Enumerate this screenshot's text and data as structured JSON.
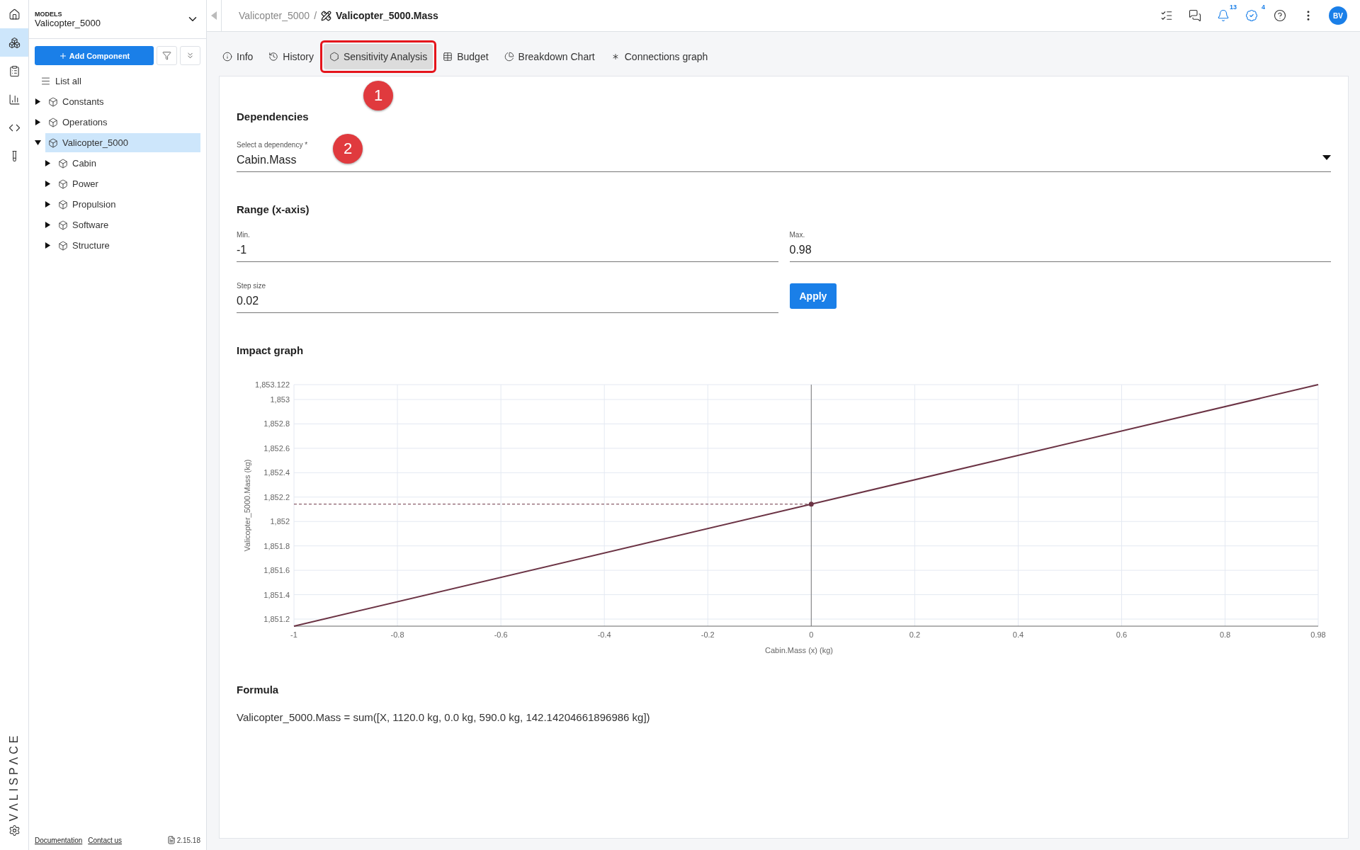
{
  "rail": {
    "items": [
      {
        "selected": false
      },
      {
        "selected": true
      },
      {
        "selected": false
      },
      {
        "selected": false
      },
      {
        "selected": false
      },
      {
        "selected": false
      }
    ],
    "logo": "VΛLISPΛCE"
  },
  "sidebar": {
    "caption": "MODELS",
    "model": "Valicopter_5000",
    "add_button": "Add Component",
    "list_all": "List all",
    "tree": [
      {
        "label": "Constants",
        "expanded": false,
        "selected": false
      },
      {
        "label": "Operations",
        "expanded": false,
        "selected": false
      },
      {
        "label": "Valicopter_5000",
        "expanded": true,
        "selected": true,
        "children": [
          {
            "label": "Cabin",
            "expanded": false,
            "selected": false
          },
          {
            "label": "Power",
            "expanded": false,
            "selected": false
          },
          {
            "label": "Propulsion",
            "expanded": false,
            "selected": false
          },
          {
            "label": "Software",
            "expanded": false,
            "selected": false
          },
          {
            "label": "Structure",
            "expanded": false,
            "selected": false
          }
        ]
      }
    ],
    "footer": {
      "links": [
        "Documentation",
        "Contact us"
      ],
      "version": "2.15.18"
    }
  },
  "topbar": {
    "breadcrumb": {
      "parent": "Valicopter_5000",
      "separator": "/",
      "current": "Valicopter_5000.Mass"
    },
    "notifications": "13",
    "tasks": "4",
    "avatar": "BV"
  },
  "tabs": [
    {
      "label": "Info",
      "selected": false
    },
    {
      "label": "History",
      "selected": false
    },
    {
      "label": "Sensitivity Analysis",
      "selected": true
    },
    {
      "label": "Budget",
      "selected": false
    },
    {
      "label": "Breakdown Chart",
      "selected": false
    },
    {
      "label": "Connections graph",
      "selected": false
    }
  ],
  "annotations": [
    {
      "kind": "tab",
      "number": "1"
    },
    {
      "kind": "dependency",
      "number": "2"
    }
  ],
  "dependencies": {
    "title": "Dependencies",
    "label": "Select a dependency *",
    "value": "Cabin.Mass"
  },
  "range": {
    "title": "Range (x-axis)",
    "min_label": "Min.",
    "min": "-1",
    "max_label": "Max.",
    "max": "0.98",
    "step_label": "Step size",
    "step": "0.02",
    "apply": "Apply"
  },
  "impact": {
    "title": "Impact graph",
    "chart_data": {
      "type": "line",
      "xlabel": "Cabin.Mass (x) (kg)",
      "ylabel": "Valicopter_5000.Mass (kg)",
      "x": [
        -1,
        0,
        0.98
      ],
      "series": [
        {
          "color": "#6b3344",
          "values": [
            1851.142,
            1852.142,
            1853.122
          ]
        }
      ],
      "grid": true,
      "xlim": [
        -1,
        0.98
      ],
      "ylim": [
        1851.142,
        1853.122
      ],
      "xticks": [
        -1,
        -0.8,
        -0.6,
        -0.4,
        -0.2,
        0,
        0.2,
        0.4,
        0.6,
        0.8,
        0.98
      ],
      "yticks": [
        {
          "value": 1851.2,
          "label": "1,851.2"
        },
        {
          "value": 1851.4,
          "label": "1,851.4"
        },
        {
          "value": 1851.6,
          "label": "1,851.6"
        },
        {
          "value": 1851.8,
          "label": "1,851.8"
        },
        {
          "value": 1852,
          "label": "1,852"
        },
        {
          "value": 1852.2,
          "label": "1,852.2"
        },
        {
          "value": 1852.4,
          "label": "1,852.4"
        },
        {
          "value": 1852.6,
          "label": "1,852.6"
        },
        {
          "value": 1852.8,
          "label": "1,852.8"
        },
        {
          "value": 1853,
          "label": "1,853"
        },
        {
          "value": 1853.122,
          "label": "1,853.122"
        }
      ],
      "ref_lines": [
        {
          "axis": "y",
          "value": 1852.142
        },
        {
          "axis": "x",
          "value": 0
        }
      ]
    }
  },
  "formula": {
    "title": "Formula",
    "text": "Valicopter_5000.Mass = sum([X, 1120.0 kg, 0.0 kg, 590.0 kg, 142.14204661896986 kg])"
  }
}
